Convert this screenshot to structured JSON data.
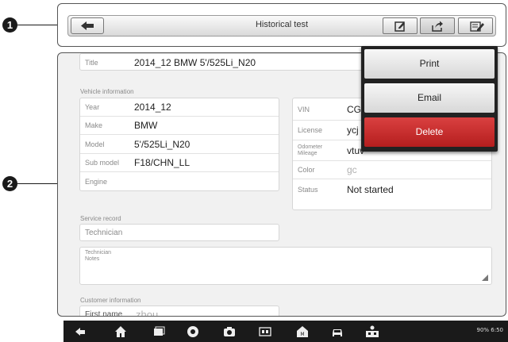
{
  "callouts": {
    "one": "1",
    "two": "2"
  },
  "toolbar": {
    "title": "Historical test"
  },
  "menu": {
    "print": "Print",
    "email": "Email",
    "delete": "Delete"
  },
  "title_field": {
    "label": "Title",
    "value": "2014_12 BMW 5'/525Li_N20"
  },
  "vehicle": {
    "section": "Vehicle information",
    "year": {
      "label": "Year",
      "value": "2014_12"
    },
    "make": {
      "label": "Make",
      "value": "BMW"
    },
    "model": {
      "label": "Model",
      "value": "5'/525Li_N20"
    },
    "submodel": {
      "label": "Sub model",
      "value": "F18/CHN_LL"
    },
    "engine": {
      "label": "Engine",
      "value": ""
    },
    "vin": {
      "label": "VIN",
      "value": "CG"
    },
    "license": {
      "label": "License",
      "value": "ycj"
    },
    "odometer": {
      "label1": "Odometer",
      "label2": "Mileage",
      "value": "vtuv"
    },
    "color": {
      "label": "Color",
      "value": "gc"
    },
    "status": {
      "label": "Status",
      "value": "Not started"
    }
  },
  "service": {
    "section": "Service record",
    "technician": {
      "label": "Technician"
    },
    "notes": {
      "label1": "Technician",
      "label2": "Notes"
    }
  },
  "customer": {
    "section": "Customer information",
    "first_name": {
      "label": "First name",
      "placeholder": "zhou"
    }
  },
  "statusbar": {
    "text": "90% 6:50"
  },
  "colors": {
    "delete_red": "#c62828",
    "background": "#f1f1f1"
  }
}
